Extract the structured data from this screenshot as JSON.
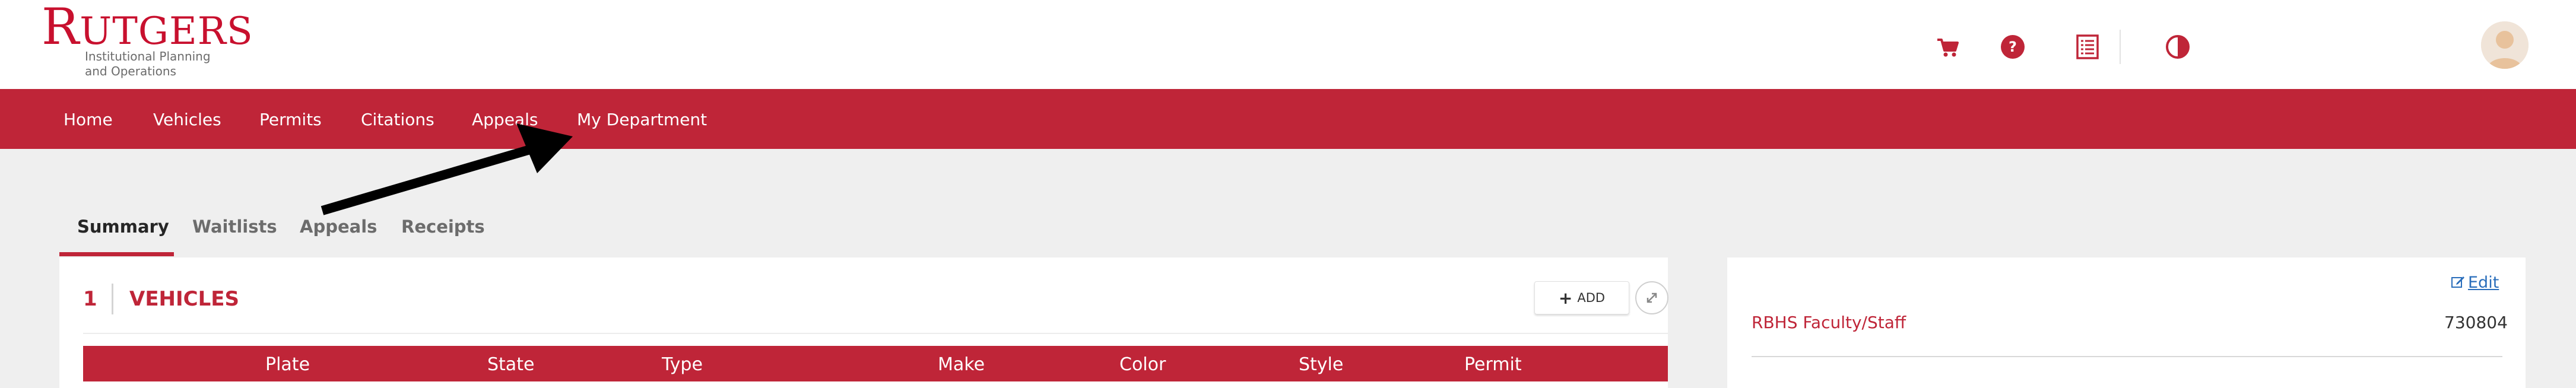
{
  "brand": {
    "name_first": "R",
    "name_rest": "UTGERS",
    "subtitle": "Institutional Planning\nand Operations"
  },
  "header": {
    "icons": [
      "cart-icon",
      "help-icon",
      "receipt-icon",
      "contrast-icon"
    ],
    "user": "avatar"
  },
  "nav": {
    "items": [
      "Home",
      "Vehicles",
      "Permits",
      "Citations",
      "Appeals",
      "My Department"
    ]
  },
  "tabs": {
    "items": [
      "Summary",
      "Waitlists",
      "Appeals",
      "Receipts"
    ],
    "active": "Summary"
  },
  "vehicles": {
    "count": "1",
    "title": "VEHICLES",
    "add_label": "ADD",
    "columns": [
      "Plate",
      "State",
      "Type",
      "Make",
      "Color",
      "Style",
      "Permit"
    ]
  },
  "permit": {
    "edit_label": "Edit",
    "label": "RBHS Faculty/Staff",
    "value": "730804"
  },
  "colors": {
    "brand_red": "#bf2538",
    "link_blue": "#2a6ebb"
  }
}
